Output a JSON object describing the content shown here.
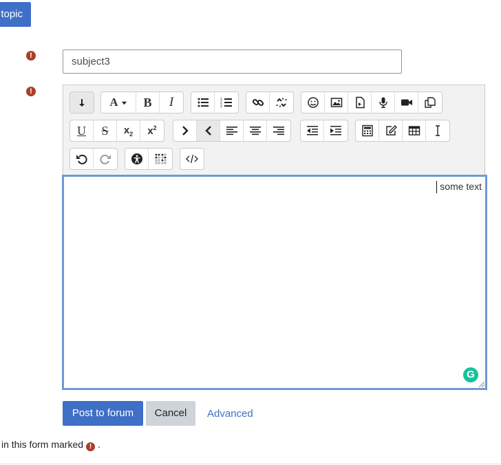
{
  "header": {
    "topic_button_label": "topic"
  },
  "form": {
    "required_icon": "exclamation-circle-icon",
    "subject": {
      "value": "subject3",
      "placeholder": ""
    },
    "editor": {
      "content_text": "some text",
      "toolbar_row1": [
        "collapse-toolbar-icon",
        "font-color-icon",
        "bold-icon",
        "italic-icon",
        "unordered-list-icon",
        "ordered-list-icon",
        "link-icon",
        "unlink-icon",
        "emoji-icon",
        "image-icon",
        "media-file-icon",
        "record-audio-icon",
        "record-video-icon",
        "manage-files-icon"
      ],
      "toolbar_row2": [
        "underline-icon",
        "strikethrough-icon",
        "subscript-icon",
        "superscript-icon",
        "ltr-icon",
        "rtl-icon",
        "align-left-icon",
        "align-center-icon",
        "align-right-icon",
        "outdent-icon",
        "indent-icon",
        "equation-icon",
        "special-character-icon",
        "table-icon",
        "clear-formatting-icon"
      ],
      "toolbar_row3": [
        "undo-icon",
        "redo-icon",
        "accessibility-checker-icon",
        "screenreader-helper-icon",
        "html-icon"
      ],
      "labels": {
        "bold": "B",
        "italic": "I",
        "underline": "U",
        "strike": "S",
        "font": "A",
        "grammarly": "G"
      }
    }
  },
  "actions": {
    "post_label": "Post to forum",
    "cancel_label": "Cancel",
    "advanced_label": "Advanced"
  },
  "footer": {
    "required_prefix": "in this form marked",
    "required_suffix": "."
  },
  "colors": {
    "primary": "#3f6fc6",
    "required": "#ab3f29",
    "editor_focus": "#6f98d4",
    "grammarly": "#15c39a"
  }
}
